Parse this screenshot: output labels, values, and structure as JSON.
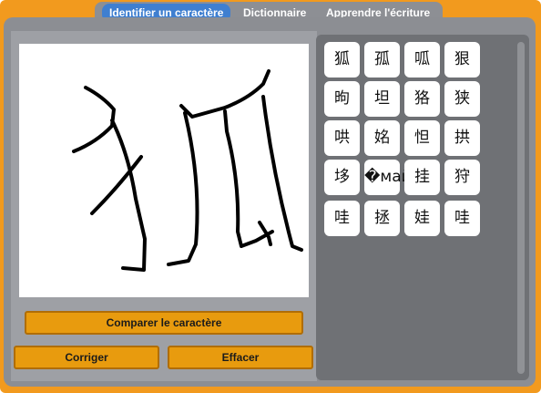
{
  "tabs": [
    {
      "label": "Identifier un caractère",
      "active": true
    },
    {
      "label": "Dictionnaire",
      "active": false
    },
    {
      "label": "Apprendre l'écriture",
      "active": false
    }
  ],
  "buttons": {
    "compare": "Comparer le caractère",
    "correct": "Corriger",
    "clear": "Effacer"
  },
  "candidates": [
    "狐",
    "孤",
    "呱",
    "狠",
    "昫",
    "坦",
    "狢",
    "狭",
    "哄",
    "姳",
    "怛",
    "拱",
    "垑",
    "�майн",
    "挂",
    "狩",
    "哇",
    "拯",
    "娃",
    "哇"
  ],
  "colors": {
    "frame": "#f29a1e",
    "active_tab": "#3f7fd0",
    "button": "#e89b0e",
    "panel": "#8c8e93"
  }
}
